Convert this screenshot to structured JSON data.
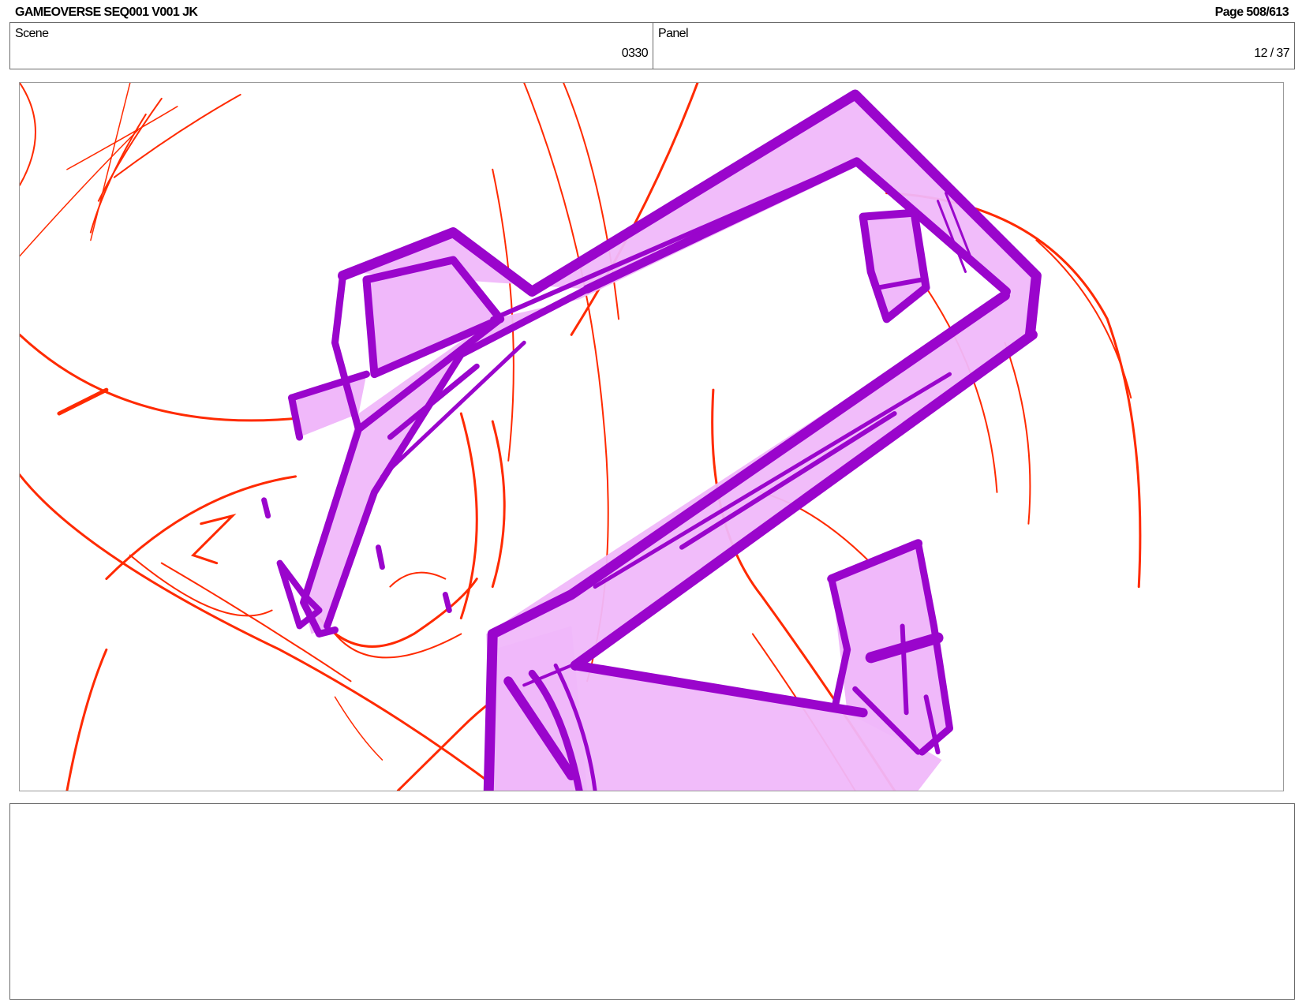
{
  "header": {
    "title": "GAMEOVERSE SEQ001 V001 JK",
    "page": "Page 508/613"
  },
  "info": {
    "scene_label": "Scene",
    "scene_value": "0330",
    "panel_label": "Panel",
    "panel_value": "12 / 37"
  },
  "notes": {
    "text": ""
  },
  "colors": {
    "sketch_line": "#ff2a00",
    "prop_outline": "#9a05cc",
    "prop_fill": "#f0b8fa",
    "border": "#6b6b6b"
  }
}
